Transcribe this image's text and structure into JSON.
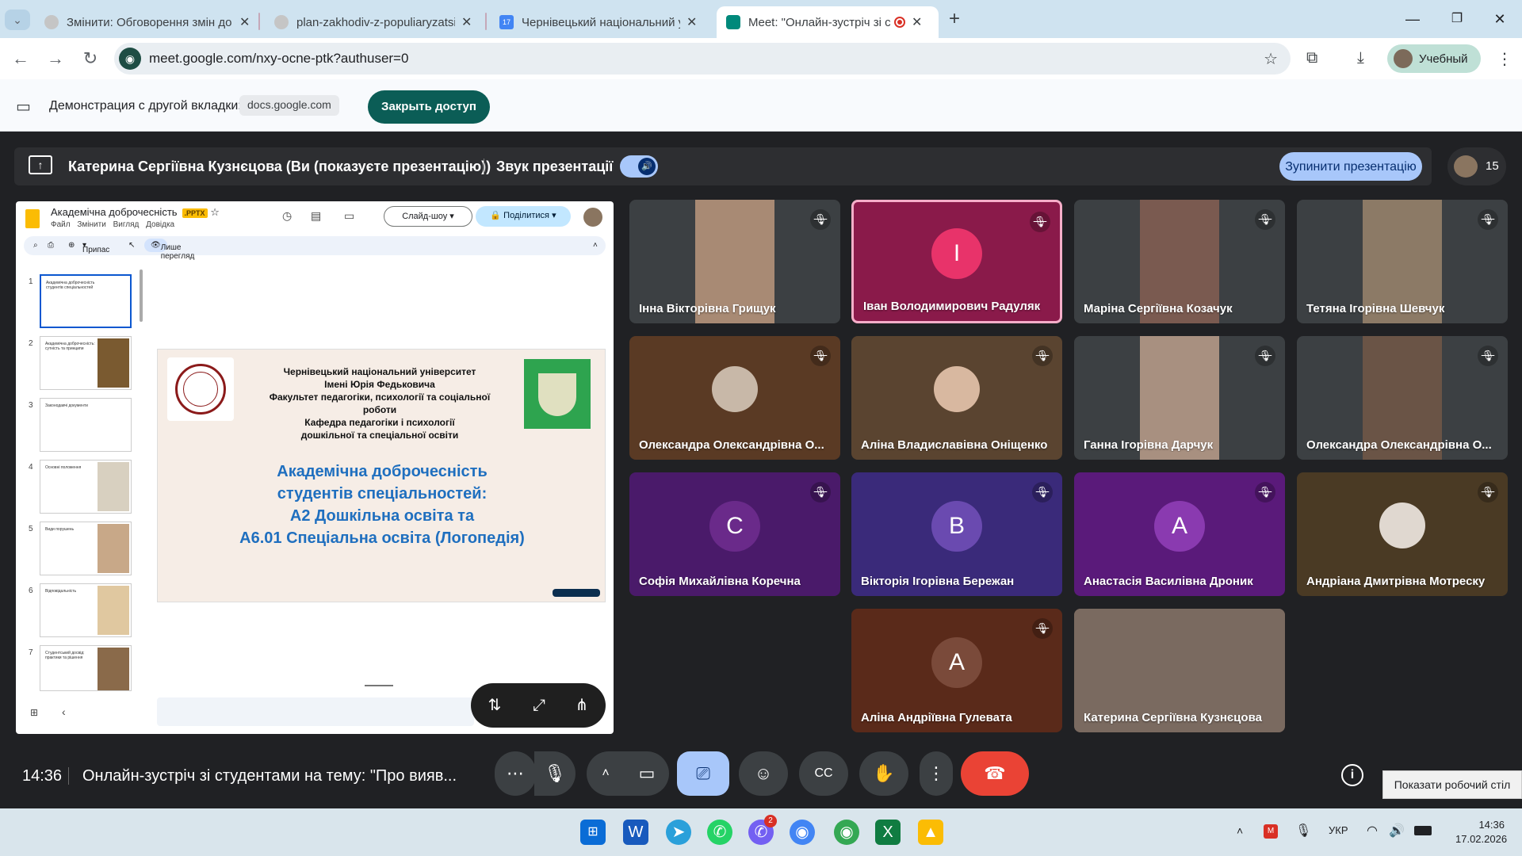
{
  "browser": {
    "tabs": [
      {
        "title": "Змінити: Обговорення змін до",
        "favicon_color": "#c5c5c5"
      },
      {
        "title": "plan-zakhodiv-z-populiaryzatsii",
        "favicon_color": "#c5c5c5"
      },
      {
        "title": "Чернівецький національний у",
        "favicon_color": "#4285f4"
      },
      {
        "title": "Meet: \"Онлайн-зустріч зі с",
        "favicon_color": "#00897b"
      }
    ],
    "new_tab": "+",
    "url": "meet.google.com/nxy-ocne-ptk?authuser=0",
    "profile_label": "Учебный"
  },
  "infobar": {
    "label": "Демонстрация с другой вкладки:",
    "source": "docs.google.com",
    "close_button": "Закрыть доступ"
  },
  "presenting_bar": {
    "presenter": "Катерина Сергіївна Кузнєцова (Ви (показуєте презентацію))",
    "sound_label": "Звук презентації",
    "stop_button": "Зупинити презентацію",
    "participant_count": "15"
  },
  "slides": {
    "doc_title": "Академічна доброчесність",
    "badge": ".PPTX",
    "menu": [
      "Файл",
      "Змінити",
      "Вигляд",
      "Довідка"
    ],
    "slideshow_button": "Слайд-шоу",
    "share_button": "Поділитися",
    "toolbar_zoom": "Припас",
    "toolbar_view": "Лише перегляд",
    "thumbnails": [
      {
        "num": "1",
        "text": "Академічна доброчесність студентів спеціальностей"
      },
      {
        "num": "2",
        "text": "Академічна доброчесність: сутність та принципи"
      },
      {
        "num": "3",
        "text": "Законодавчі документи"
      },
      {
        "num": "4",
        "text": "Основні положення"
      },
      {
        "num": "5",
        "text": "Види порушень"
      },
      {
        "num": "6",
        "text": "Відповідальність"
      },
      {
        "num": "7",
        "text": "Студентський досвід: практики та рішення"
      }
    ],
    "main_slide": {
      "header_lines": [
        "Чернівецький національний університет",
        "Імені Юрія Федьковича",
        "Факультет педагогіки, психології та соціальної роботи",
        "Кафедра педагогіки і психології",
        "дошкільної та спеціальної освіти"
      ],
      "title_lines": [
        "Академічна доброчесність",
        "студентів спеціальностей:",
        "А2 Дошкільна освіта та",
        "А6.01 Спеціальна освіта (Логопедія)"
      ]
    }
  },
  "participants": [
    {
      "name": "Інна Вікторівна Грищук",
      "type": "photo",
      "bg": "#3c4043",
      "photo": "#a88a74"
    },
    {
      "name": "Іван Володимирович Радуляк",
      "type": "avatar",
      "letter": "І",
      "bg": "#8a1a4a",
      "avatar": "#e8336a",
      "speaking": true
    },
    {
      "name": "Маріна Сергіївна Козачук",
      "type": "photo",
      "bg": "#3c4043",
      "photo": "#7a5a50"
    },
    {
      "name": "Тетяна Ігорівна Шевчук",
      "type": "photo",
      "bg": "#3c4043",
      "photo": "#8c7a66"
    },
    {
      "name": "Олександра Олександрівна О...",
      "type": "photoav",
      "bg": "#5a3a24",
      "photo": "#c8b8a8"
    },
    {
      "name": "Аліна Владиславівна Оніщенко",
      "type": "photoav",
      "bg": "#5a4430",
      "photo": "#d8b8a0"
    },
    {
      "name": "Ганна Ігорівна Дарчук",
      "type": "photo",
      "bg": "#3c4043",
      "photo": "#a89080"
    },
    {
      "name": "Олександра Олександрівна О...",
      "type": "photo",
      "bg": "#3c4043",
      "photo": "#6a5446"
    },
    {
      "name": "Софія Михайлівна Коречна",
      "type": "avatar",
      "letter": "С",
      "bg": "#4a1a6a",
      "avatar": "#6a2a8a"
    },
    {
      "name": "Вікторія Ігорівна Бережан",
      "type": "avatar",
      "letter": "В",
      "bg": "#3a2a7a",
      "avatar": "#6a4ab0"
    },
    {
      "name": "Анастасія Василівна Дроник",
      "type": "avatar",
      "letter": "А",
      "bg": "#5a1a7a",
      "avatar": "#8a3ab0"
    },
    {
      "name": "Андріана Дмитрівна Мотреску",
      "type": "photoav",
      "bg": "#4a3a24",
      "photo": "#e0d8d0"
    },
    {
      "name": "Аліна Андріївна Гулевата",
      "type": "avatar",
      "letter": "А",
      "bg": "#5a2a1a",
      "avatar": "#7a4a3a"
    },
    {
      "name": "Катерина Сергіївна Кузнєцова",
      "type": "photo",
      "bg": "#6a5a50",
      "photo": "#7a6a60",
      "wide": true
    }
  ],
  "bottom_bar": {
    "time": "14:36",
    "meeting_title": "Онлайн-зустріч зі студентами на тему: \"Про вияв..."
  },
  "tooltip": "Показати робочий стіл",
  "taskbar": {
    "language": "УКР",
    "time": "14:36",
    "date": "17.02.2026",
    "viber_badge": "2"
  },
  "colors": {
    "end_call": "#ea4335",
    "accent": "#a8c7fa",
    "close_access": "#0b5d56"
  }
}
